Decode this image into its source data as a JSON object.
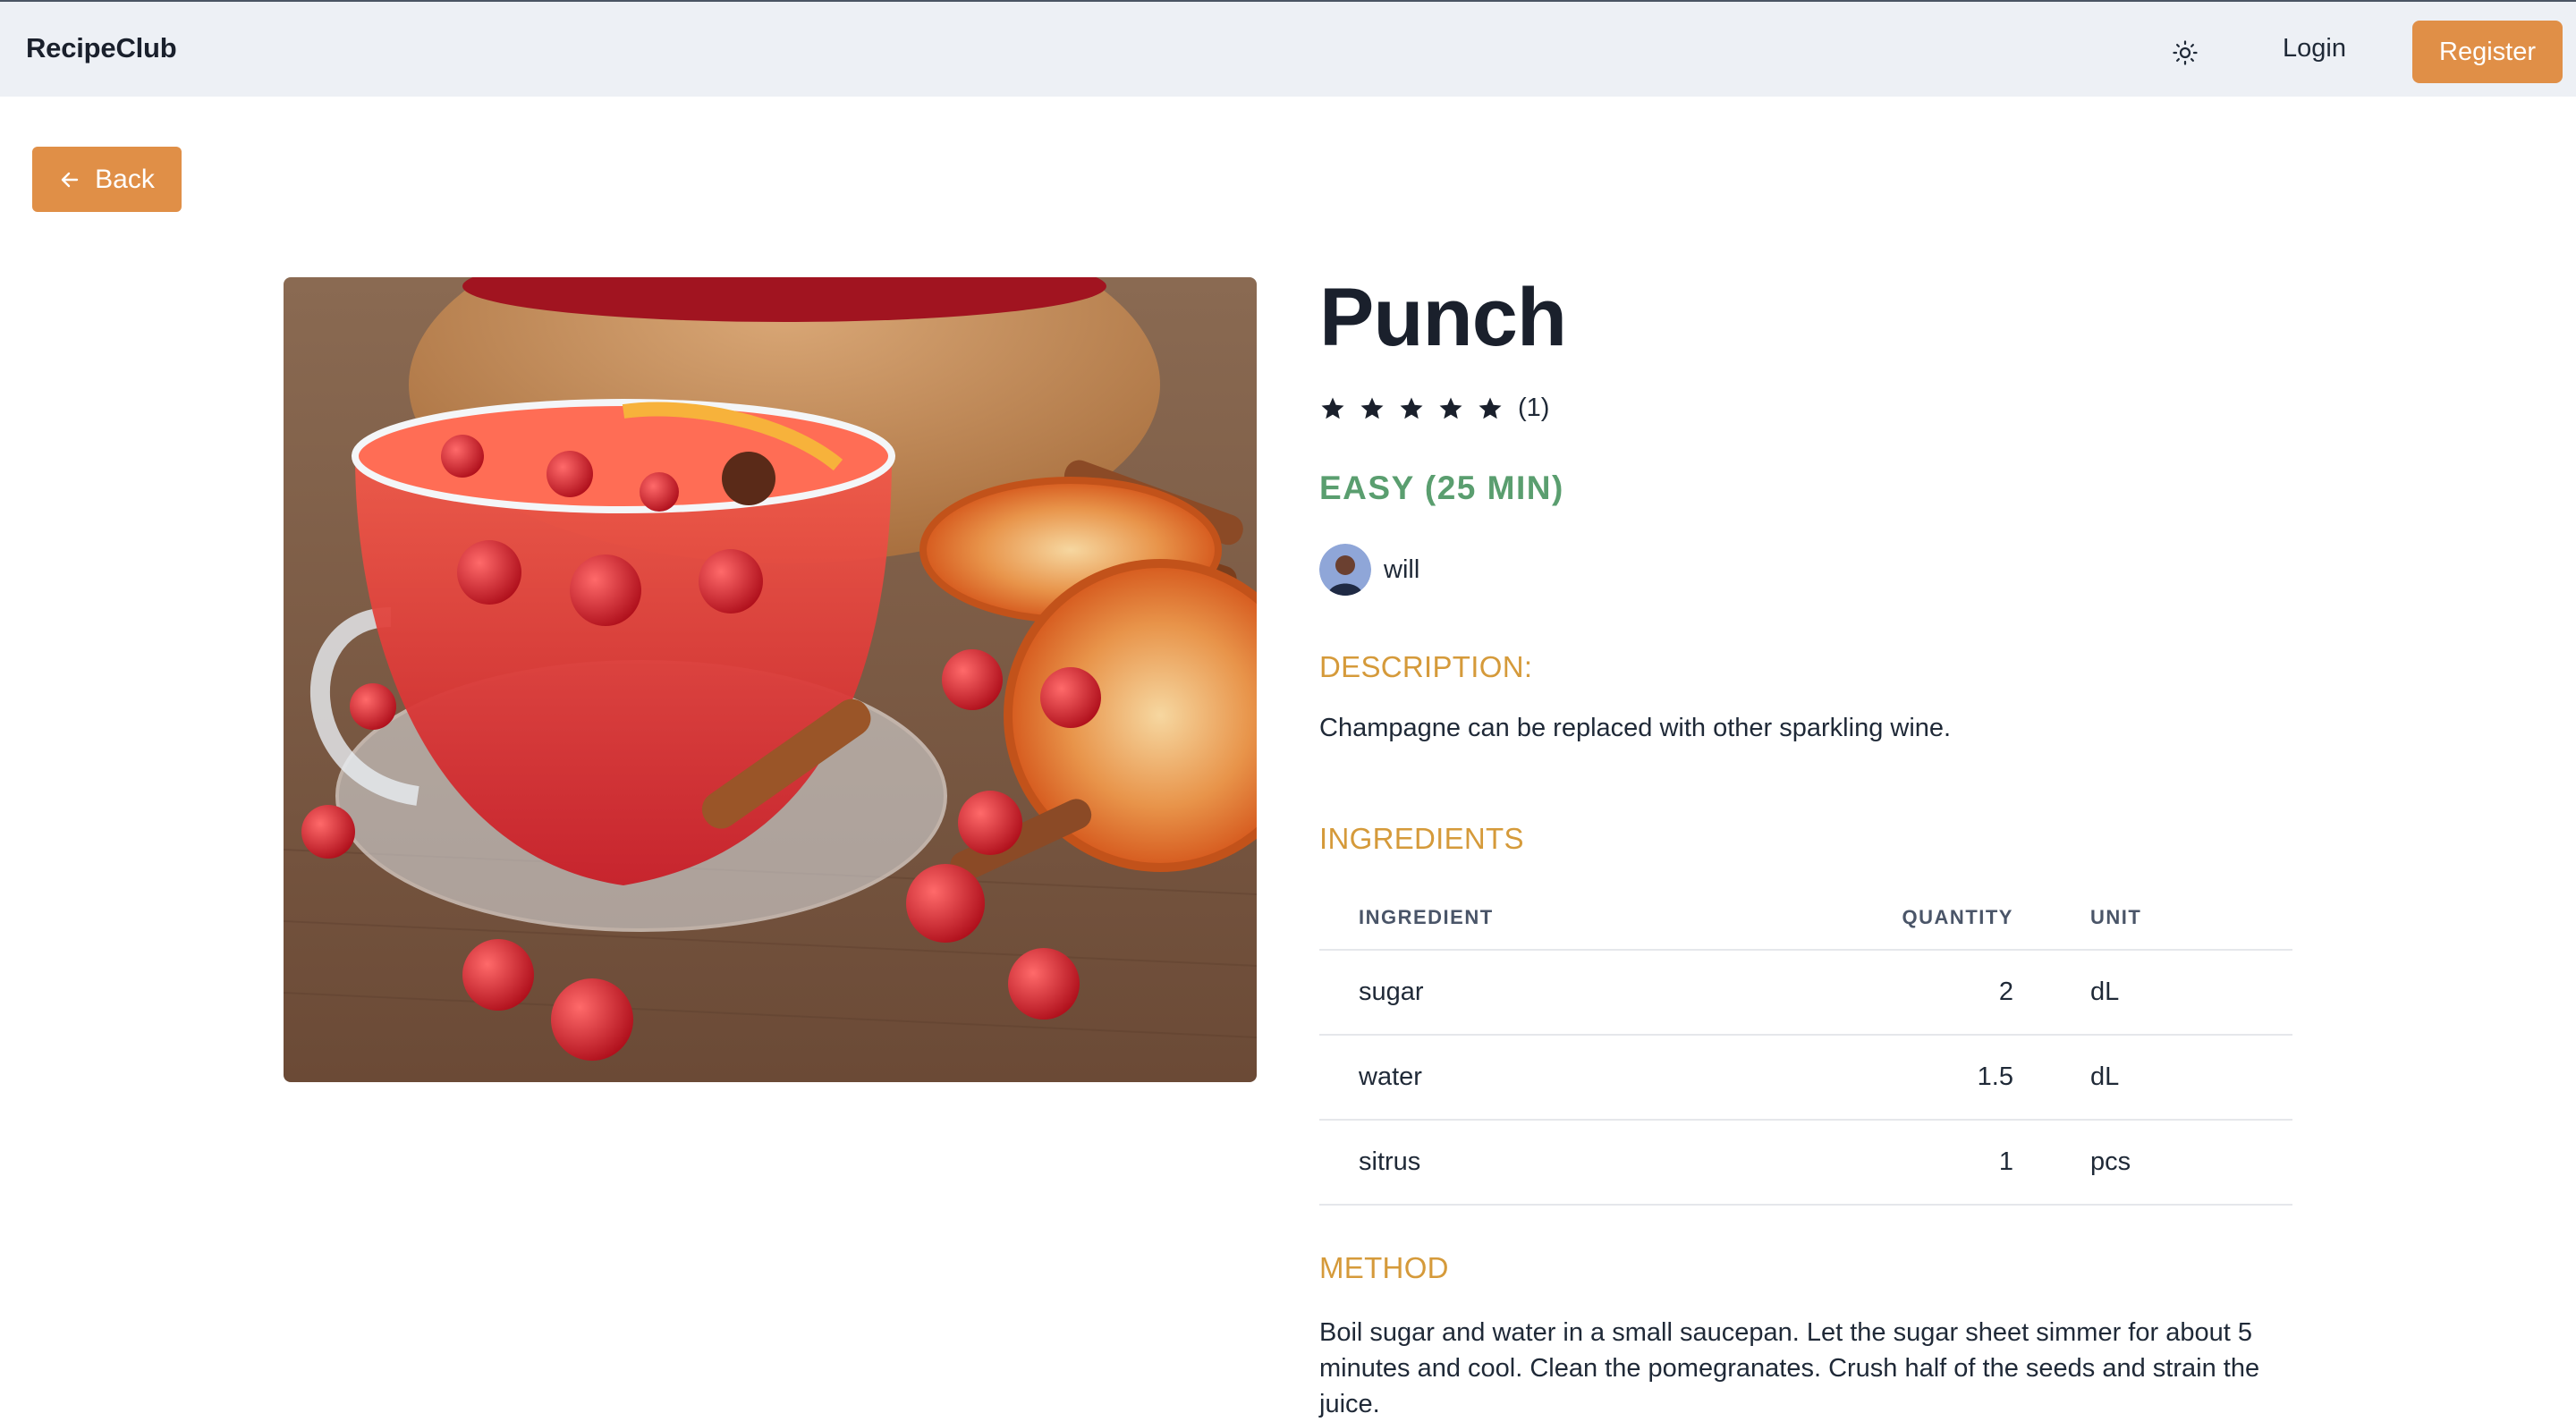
{
  "nav": {
    "brand": "RecipeClub",
    "theme_icon": "sun-icon",
    "login_label": "Login",
    "register_label": "Register"
  },
  "back": {
    "label": "Back",
    "icon": "arrow-left-icon"
  },
  "recipe": {
    "title": "Punch",
    "rating": {
      "stars": 5,
      "count_label": "(1)"
    },
    "difficulty": "EASY (25 MIN)",
    "author": "will",
    "description_heading": "DESCRIPTION:",
    "description": "Champagne can be replaced with other sparkling wine.",
    "ingredients_heading": "INGREDIENTS",
    "table_headers": {
      "ingredient": "INGREDIENT",
      "quantity": "QUANTITY",
      "unit": "UNIT"
    },
    "ingredients": [
      {
        "name": "sugar",
        "quantity": "2",
        "unit": "dL"
      },
      {
        "name": "water",
        "quantity": "1.5",
        "unit": "dL"
      },
      {
        "name": "sitrus",
        "quantity": "1",
        "unit": "pcs"
      }
    ],
    "method_heading": "METHOD",
    "method": "Boil sugar and water in a small saucepan. Let the sugar sheet simmer for about 5 minutes and cool. Clean the pomegranates. Crush half of the seeds and strain the juice."
  },
  "colors": {
    "accent": "#e08f47",
    "heading_gold": "#d59a3a",
    "difficulty_green": "#5a9e6f",
    "nav_bg": "#edf0f5"
  }
}
